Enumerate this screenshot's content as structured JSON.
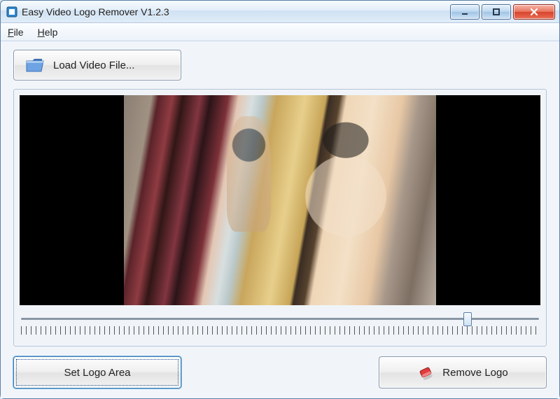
{
  "titlebar": {
    "title": "Easy Video Logo Remover V1.2.3"
  },
  "menubar": {
    "file": "File",
    "help": "Help"
  },
  "actions": {
    "load_video": "Load Video File...",
    "set_logo_area": "Set Logo Area",
    "remove_logo": "Remove Logo"
  },
  "slider": {
    "position_percent": 86
  }
}
